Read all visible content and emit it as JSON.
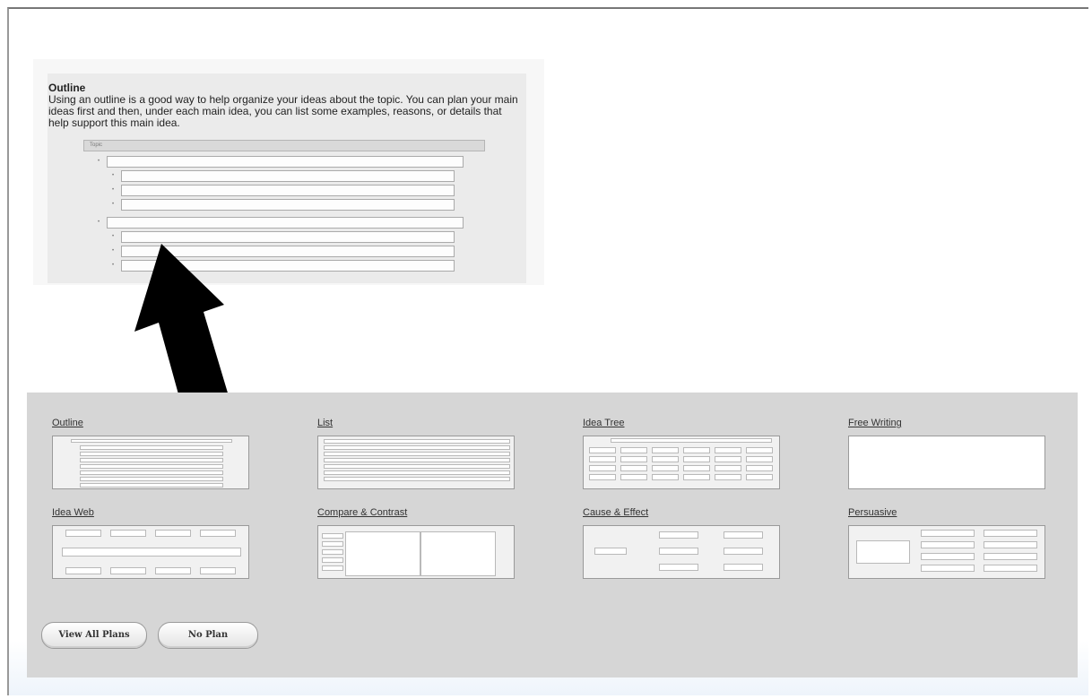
{
  "preview": {
    "title": "Outline",
    "description": "Using an outline is a good way to help organize your ideas about the topic. You can plan your main ideas first and then, under each main idea, you can list some examples, reasons, or details that help support this main idea.",
    "topic_label": "Topic"
  },
  "plans": [
    {
      "label": "Outline",
      "thumb": "outline"
    },
    {
      "label": "List",
      "thumb": "list"
    },
    {
      "label": "Idea Tree",
      "thumb": "tree"
    },
    {
      "label": "Free Writing",
      "thumb": "blank"
    },
    {
      "label": "Idea Web",
      "thumb": "web"
    },
    {
      "label": "Compare & Contrast",
      "thumb": "compare"
    },
    {
      "label": "Cause & Effect",
      "thumb": "cause"
    },
    {
      "label": "Persuasive",
      "thumb": "persuasive"
    }
  ],
  "buttons": {
    "view_all": "View All Plans",
    "no_plan": "No Plan"
  },
  "arrow_icon": "arrow-up-left-icon"
}
